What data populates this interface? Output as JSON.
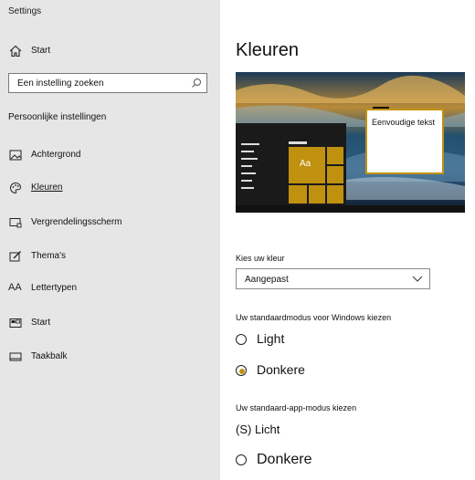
{
  "app": {
    "title": "Settings"
  },
  "sidebar": {
    "home_label": "Start",
    "search_placeholder": "Een instelling zoeken",
    "section_title": "Persoonlijke instellingen",
    "items": [
      {
        "label": "Achtergrond",
        "icon": "picture-icon"
      },
      {
        "label": "Kleuren",
        "icon": "palette-icon",
        "selected": true
      },
      {
        "label": "Vergrendelingsscherm",
        "icon": "lock-screen-icon"
      },
      {
        "label": "Thema's",
        "icon": "theme-icon"
      },
      {
        "label": "Lettertypen",
        "icon": "font-icon",
        "glyph": "AA"
      },
      {
        "label": "Start",
        "icon": "start-icon"
      },
      {
        "label": "Taakbalk",
        "icon": "taskbar-icon"
      }
    ]
  },
  "main": {
    "title": "Kleuren",
    "preview": {
      "sample_text": "Eenvoudige tekst",
      "tile_text": "Aa"
    },
    "color_choice": {
      "label": "Kies uw kleur",
      "value": "Aangepast"
    },
    "windows_mode": {
      "label": "Uw standaardmodus voor Windows kiezen",
      "options": [
        "Light",
        "Donkere"
      ],
      "selected": "Donkere"
    },
    "app_mode": {
      "label": "Uw standaard-app-modus kiezen",
      "options": [
        "(S) Licht",
        "Donkere"
      ]
    }
  },
  "colors": {
    "accent": "#c0910f",
    "sidebar_bg": "#e6e6e6"
  }
}
